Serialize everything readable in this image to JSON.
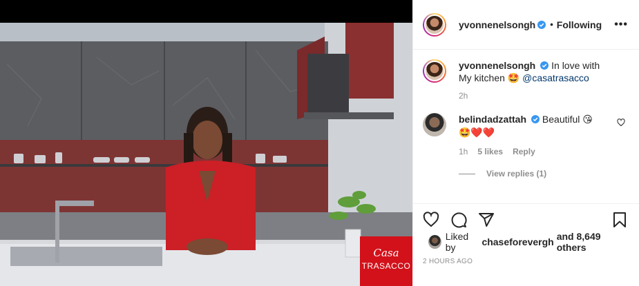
{
  "post": {
    "author": "yvonnenelsongh",
    "follow_status": "Following",
    "separator": "•",
    "more_glyph": "•••",
    "verified": true
  },
  "media": {
    "brand_line1": "Casa",
    "brand_line2": "TRASACCO"
  },
  "caption": {
    "username": "yvonnenelsongh",
    "text": "In love with My kitchen",
    "emoji": "🤩",
    "mention": "@casatrasacco",
    "time": "2h"
  },
  "comments": [
    {
      "username": "belindadzattah",
      "text": "Beautiful",
      "emoji_line1": "😘",
      "emoji_line2": "🤩❤️❤️",
      "time": "1h",
      "likes": "5 likes",
      "reply_label": "Reply",
      "view_replies": "View replies (1)"
    }
  ],
  "liked_by": {
    "prefix": "Liked by",
    "user": "chaseforevergh",
    "suffix": "and 8,649 others"
  },
  "timestamp": "2 HOURS AGO",
  "colors": {
    "brand_red": "#d3111a",
    "link": "#00376b",
    "verified": "#3897f0",
    "muted": "#8e8e8e"
  },
  "icons": [
    "heart-icon",
    "comment-icon",
    "share-icon",
    "bookmark-icon",
    "verified-icon",
    "more-icon"
  ]
}
